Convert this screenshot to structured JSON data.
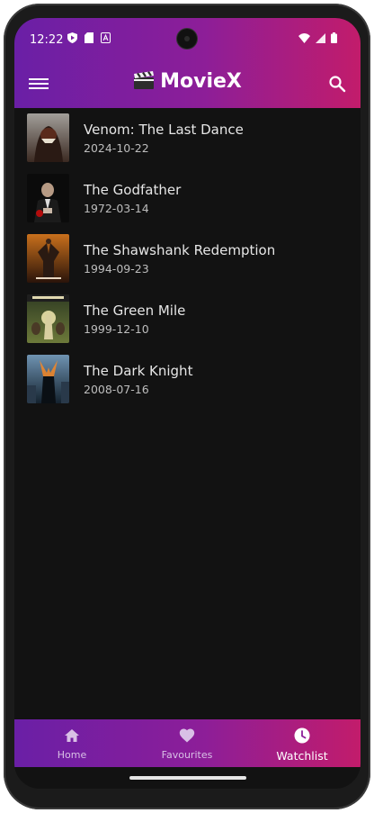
{
  "status": {
    "time": "12:22"
  },
  "appbar": {
    "title": "MovieX"
  },
  "movies": [
    {
      "title": "Venom: The Last Dance",
      "date": "2024-10-22"
    },
    {
      "title": "The Godfather",
      "date": "1972-03-14"
    },
    {
      "title": "The Shawshank Redemption",
      "date": "1994-09-23"
    },
    {
      "title": "The Green Mile",
      "date": "1999-12-10"
    },
    {
      "title": "The Dark Knight",
      "date": "2008-07-16"
    }
  ],
  "bottom_nav": [
    {
      "label": "Home",
      "icon": "home-icon",
      "active": false
    },
    {
      "label": "Favourites",
      "icon": "heart-icon",
      "active": false
    },
    {
      "label": "Watchlist",
      "icon": "clock-icon",
      "active": true
    }
  ],
  "colors": {
    "gradient_start": "#6a1fa6",
    "gradient_end": "#c21c6b",
    "background": "#121212"
  }
}
